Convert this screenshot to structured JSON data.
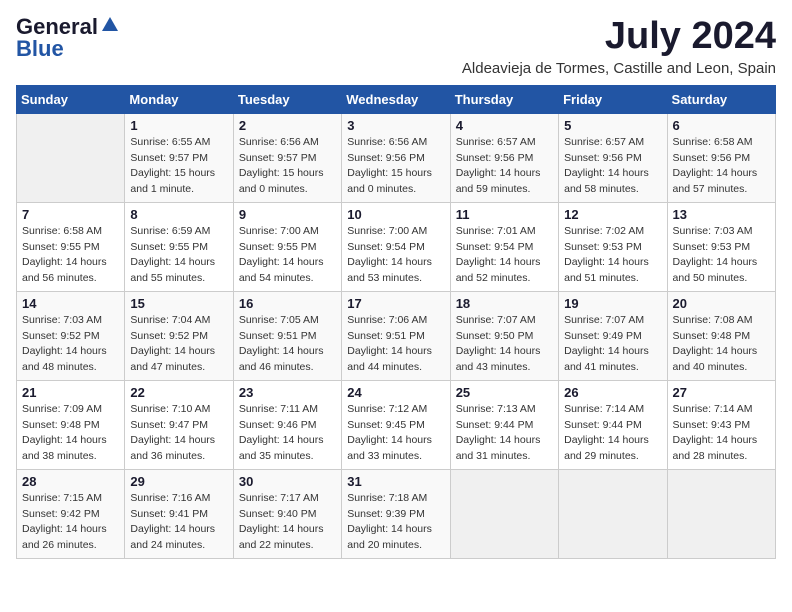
{
  "logo": {
    "general": "General",
    "blue": "Blue"
  },
  "title": "July 2024",
  "location": "Aldeavieja de Tormes, Castille and Leon, Spain",
  "days_header": [
    "Sunday",
    "Monday",
    "Tuesday",
    "Wednesday",
    "Thursday",
    "Friday",
    "Saturday"
  ],
  "weeks": [
    [
      {
        "num": "",
        "detail": ""
      },
      {
        "num": "1",
        "detail": "Sunrise: 6:55 AM\nSunset: 9:57 PM\nDaylight: 15 hours\nand 1 minute."
      },
      {
        "num": "2",
        "detail": "Sunrise: 6:56 AM\nSunset: 9:57 PM\nDaylight: 15 hours\nand 0 minutes."
      },
      {
        "num": "3",
        "detail": "Sunrise: 6:56 AM\nSunset: 9:56 PM\nDaylight: 15 hours\nand 0 minutes."
      },
      {
        "num": "4",
        "detail": "Sunrise: 6:57 AM\nSunset: 9:56 PM\nDaylight: 14 hours\nand 59 minutes."
      },
      {
        "num": "5",
        "detail": "Sunrise: 6:57 AM\nSunset: 9:56 PM\nDaylight: 14 hours\nand 58 minutes."
      },
      {
        "num": "6",
        "detail": "Sunrise: 6:58 AM\nSunset: 9:56 PM\nDaylight: 14 hours\nand 57 minutes."
      }
    ],
    [
      {
        "num": "7",
        "detail": "Sunrise: 6:58 AM\nSunset: 9:55 PM\nDaylight: 14 hours\nand 56 minutes."
      },
      {
        "num": "8",
        "detail": "Sunrise: 6:59 AM\nSunset: 9:55 PM\nDaylight: 14 hours\nand 55 minutes."
      },
      {
        "num": "9",
        "detail": "Sunrise: 7:00 AM\nSunset: 9:55 PM\nDaylight: 14 hours\nand 54 minutes."
      },
      {
        "num": "10",
        "detail": "Sunrise: 7:00 AM\nSunset: 9:54 PM\nDaylight: 14 hours\nand 53 minutes."
      },
      {
        "num": "11",
        "detail": "Sunrise: 7:01 AM\nSunset: 9:54 PM\nDaylight: 14 hours\nand 52 minutes."
      },
      {
        "num": "12",
        "detail": "Sunrise: 7:02 AM\nSunset: 9:53 PM\nDaylight: 14 hours\nand 51 minutes."
      },
      {
        "num": "13",
        "detail": "Sunrise: 7:03 AM\nSunset: 9:53 PM\nDaylight: 14 hours\nand 50 minutes."
      }
    ],
    [
      {
        "num": "14",
        "detail": "Sunrise: 7:03 AM\nSunset: 9:52 PM\nDaylight: 14 hours\nand 48 minutes."
      },
      {
        "num": "15",
        "detail": "Sunrise: 7:04 AM\nSunset: 9:52 PM\nDaylight: 14 hours\nand 47 minutes."
      },
      {
        "num": "16",
        "detail": "Sunrise: 7:05 AM\nSunset: 9:51 PM\nDaylight: 14 hours\nand 46 minutes."
      },
      {
        "num": "17",
        "detail": "Sunrise: 7:06 AM\nSunset: 9:51 PM\nDaylight: 14 hours\nand 44 minutes."
      },
      {
        "num": "18",
        "detail": "Sunrise: 7:07 AM\nSunset: 9:50 PM\nDaylight: 14 hours\nand 43 minutes."
      },
      {
        "num": "19",
        "detail": "Sunrise: 7:07 AM\nSunset: 9:49 PM\nDaylight: 14 hours\nand 41 minutes."
      },
      {
        "num": "20",
        "detail": "Sunrise: 7:08 AM\nSunset: 9:48 PM\nDaylight: 14 hours\nand 40 minutes."
      }
    ],
    [
      {
        "num": "21",
        "detail": "Sunrise: 7:09 AM\nSunset: 9:48 PM\nDaylight: 14 hours\nand 38 minutes."
      },
      {
        "num": "22",
        "detail": "Sunrise: 7:10 AM\nSunset: 9:47 PM\nDaylight: 14 hours\nand 36 minutes."
      },
      {
        "num": "23",
        "detail": "Sunrise: 7:11 AM\nSunset: 9:46 PM\nDaylight: 14 hours\nand 35 minutes."
      },
      {
        "num": "24",
        "detail": "Sunrise: 7:12 AM\nSunset: 9:45 PM\nDaylight: 14 hours\nand 33 minutes."
      },
      {
        "num": "25",
        "detail": "Sunrise: 7:13 AM\nSunset: 9:44 PM\nDaylight: 14 hours\nand 31 minutes."
      },
      {
        "num": "26",
        "detail": "Sunrise: 7:14 AM\nSunset: 9:44 PM\nDaylight: 14 hours\nand 29 minutes."
      },
      {
        "num": "27",
        "detail": "Sunrise: 7:14 AM\nSunset: 9:43 PM\nDaylight: 14 hours\nand 28 minutes."
      }
    ],
    [
      {
        "num": "28",
        "detail": "Sunrise: 7:15 AM\nSunset: 9:42 PM\nDaylight: 14 hours\nand 26 minutes."
      },
      {
        "num": "29",
        "detail": "Sunrise: 7:16 AM\nSunset: 9:41 PM\nDaylight: 14 hours\nand 24 minutes."
      },
      {
        "num": "30",
        "detail": "Sunrise: 7:17 AM\nSunset: 9:40 PM\nDaylight: 14 hours\nand 22 minutes."
      },
      {
        "num": "31",
        "detail": "Sunrise: 7:18 AM\nSunset: 9:39 PM\nDaylight: 14 hours\nand 20 minutes."
      },
      {
        "num": "",
        "detail": ""
      },
      {
        "num": "",
        "detail": ""
      },
      {
        "num": "",
        "detail": ""
      }
    ]
  ]
}
